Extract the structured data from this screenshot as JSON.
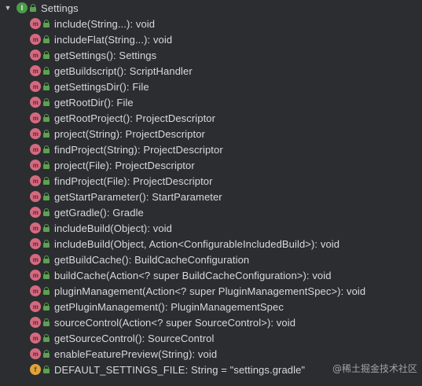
{
  "tree": {
    "root": {
      "label": "Settings",
      "class_icon_letter": "I",
      "expanded_icon": "triangle-down-icon"
    },
    "members": [
      {
        "kind": "method",
        "label": "include(String...): void"
      },
      {
        "kind": "method",
        "label": "includeFlat(String...): void"
      },
      {
        "kind": "method",
        "label": "getSettings(): Settings"
      },
      {
        "kind": "method",
        "label": "getBuildscript(): ScriptHandler"
      },
      {
        "kind": "method",
        "label": "getSettingsDir(): File"
      },
      {
        "kind": "method",
        "label": "getRootDir(): File"
      },
      {
        "kind": "method",
        "label": "getRootProject(): ProjectDescriptor"
      },
      {
        "kind": "method",
        "label": "project(String): ProjectDescriptor"
      },
      {
        "kind": "method",
        "label": "findProject(String): ProjectDescriptor"
      },
      {
        "kind": "method",
        "label": "project(File): ProjectDescriptor"
      },
      {
        "kind": "method",
        "label": "findProject(File): ProjectDescriptor"
      },
      {
        "kind": "method",
        "label": "getStartParameter(): StartParameter"
      },
      {
        "kind": "method",
        "label": "getGradle(): Gradle"
      },
      {
        "kind": "method",
        "label": "includeBuild(Object): void"
      },
      {
        "kind": "method",
        "label": "includeBuild(Object, Action<ConfigurableIncludedBuild>): void"
      },
      {
        "kind": "method",
        "label": "getBuildCache(): BuildCacheConfiguration"
      },
      {
        "kind": "method",
        "label": "buildCache(Action<? super BuildCacheConfiguration>): void"
      },
      {
        "kind": "method",
        "label": "pluginManagement(Action<? super PluginManagementSpec>): void"
      },
      {
        "kind": "method",
        "label": "getPluginManagement(): PluginManagementSpec"
      },
      {
        "kind": "method",
        "label": "sourceControl(Action<? super SourceControl>): void"
      },
      {
        "kind": "method",
        "label": "getSourceControl(): SourceControl"
      },
      {
        "kind": "method",
        "label": "enableFeaturePreview(String): void"
      },
      {
        "kind": "field",
        "label": "DEFAULT_SETTINGS_FILE: String = \"settings.gradle\""
      }
    ],
    "method_icon_letter": "m",
    "field_icon_letter": "f"
  },
  "watermark": "@稀土掘金技术社区",
  "colors": {
    "background": "#2b2d30",
    "text": "#d7d9dc",
    "class_icon": "#4d9a48",
    "method_icon": "#d26b80",
    "field_icon": "#e0a23a",
    "public_lock": "#5aa24f"
  }
}
